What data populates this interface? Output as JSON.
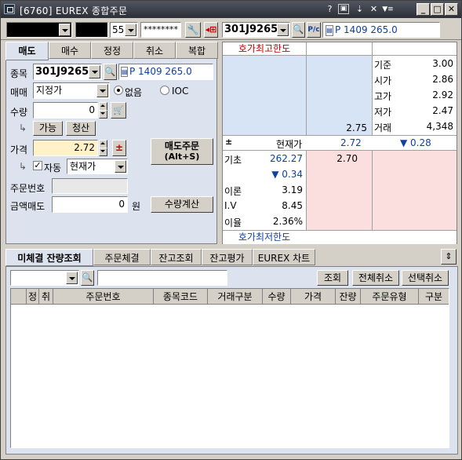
{
  "window": {
    "title": "[6760] EUREX 종합주문",
    "title_buttons": [
      "?",
      "▣",
      "⇣",
      "✕",
      "▼≡"
    ],
    "sys_buttons": [
      "_",
      "□",
      "✕"
    ]
  },
  "toolbar": {
    "account_number": "",
    "account_name": "",
    "account_sub": "55",
    "password": "********",
    "code": "301J9265",
    "code_name": "P 1409 265.0",
    "pc_badge": "P/c"
  },
  "order_tabs": [
    "매도",
    "매수",
    "정정",
    "취소",
    "복합"
  ],
  "order_form": {
    "code_label": "종목",
    "code_value": "301J9265",
    "code_name": "P 1409 265.0",
    "trade_type_label": "매매",
    "trade_type_value": "지정가",
    "cond_none": "없음",
    "cond_ioc": "IOC",
    "qty_label": "수량",
    "qty_value": "0",
    "avail_button": "가능",
    "settle_button": "청산",
    "price_label": "가격",
    "price_value": "2.72",
    "auto_label": "자동",
    "auto_price_type": "현재가",
    "sell_button_line1": "매도주문",
    "sell_button_line2": "(Alt+S)",
    "order_no_label": "주문번호",
    "order_no_value": "",
    "amount_label": "금액매도",
    "amount_value": "0",
    "amount_unit": "원",
    "qty_calc_button": "수량계산"
  },
  "quote": {
    "upper_limit_label": "호가최고한도",
    "lower_limit_label": "호가최저한도",
    "ask_price": "2.75",
    "bid_price": "2.70",
    "current_label": "현재가",
    "current_value": "2.72",
    "change": "▼ 0.28",
    "stats": [
      {
        "label": "기준",
        "value": "3.00"
      },
      {
        "label": "시가",
        "value": "2.86"
      },
      {
        "label": "고가",
        "value": "2.92"
      },
      {
        "label": "저가",
        "value": "2.47"
      },
      {
        "label": "거래",
        "value": "4,348"
      }
    ],
    "under": [
      {
        "label": "기초",
        "value": "262.27"
      },
      {
        "label": "",
        "value": "▼ 0.34"
      },
      {
        "label": "이론",
        "value": "3.19"
      },
      {
        "label": "I.V",
        "value": "8.45"
      },
      {
        "label": "이율",
        "value": "2.36%"
      }
    ]
  },
  "bottom_tabs": [
    "미체결 잔량조회",
    "주문체결",
    "잔고조회",
    "잔고평가",
    "EUREX 차트"
  ],
  "bottom_buttons": {
    "query": "조회",
    "cancel_all": "전체취소",
    "cancel_selected": "선택취소"
  },
  "table_columns": [
    "정",
    "취",
    "주문번호",
    "종목코드",
    "거래구분",
    "수량",
    "가격",
    "잔량",
    "주문유형",
    "구분"
  ],
  "colors": {
    "ask_bg": "#d6e4f5",
    "bid_bg": "#fbdede",
    "highlight_input": "#fff2c8",
    "titlebar": "#3a3e46"
  }
}
